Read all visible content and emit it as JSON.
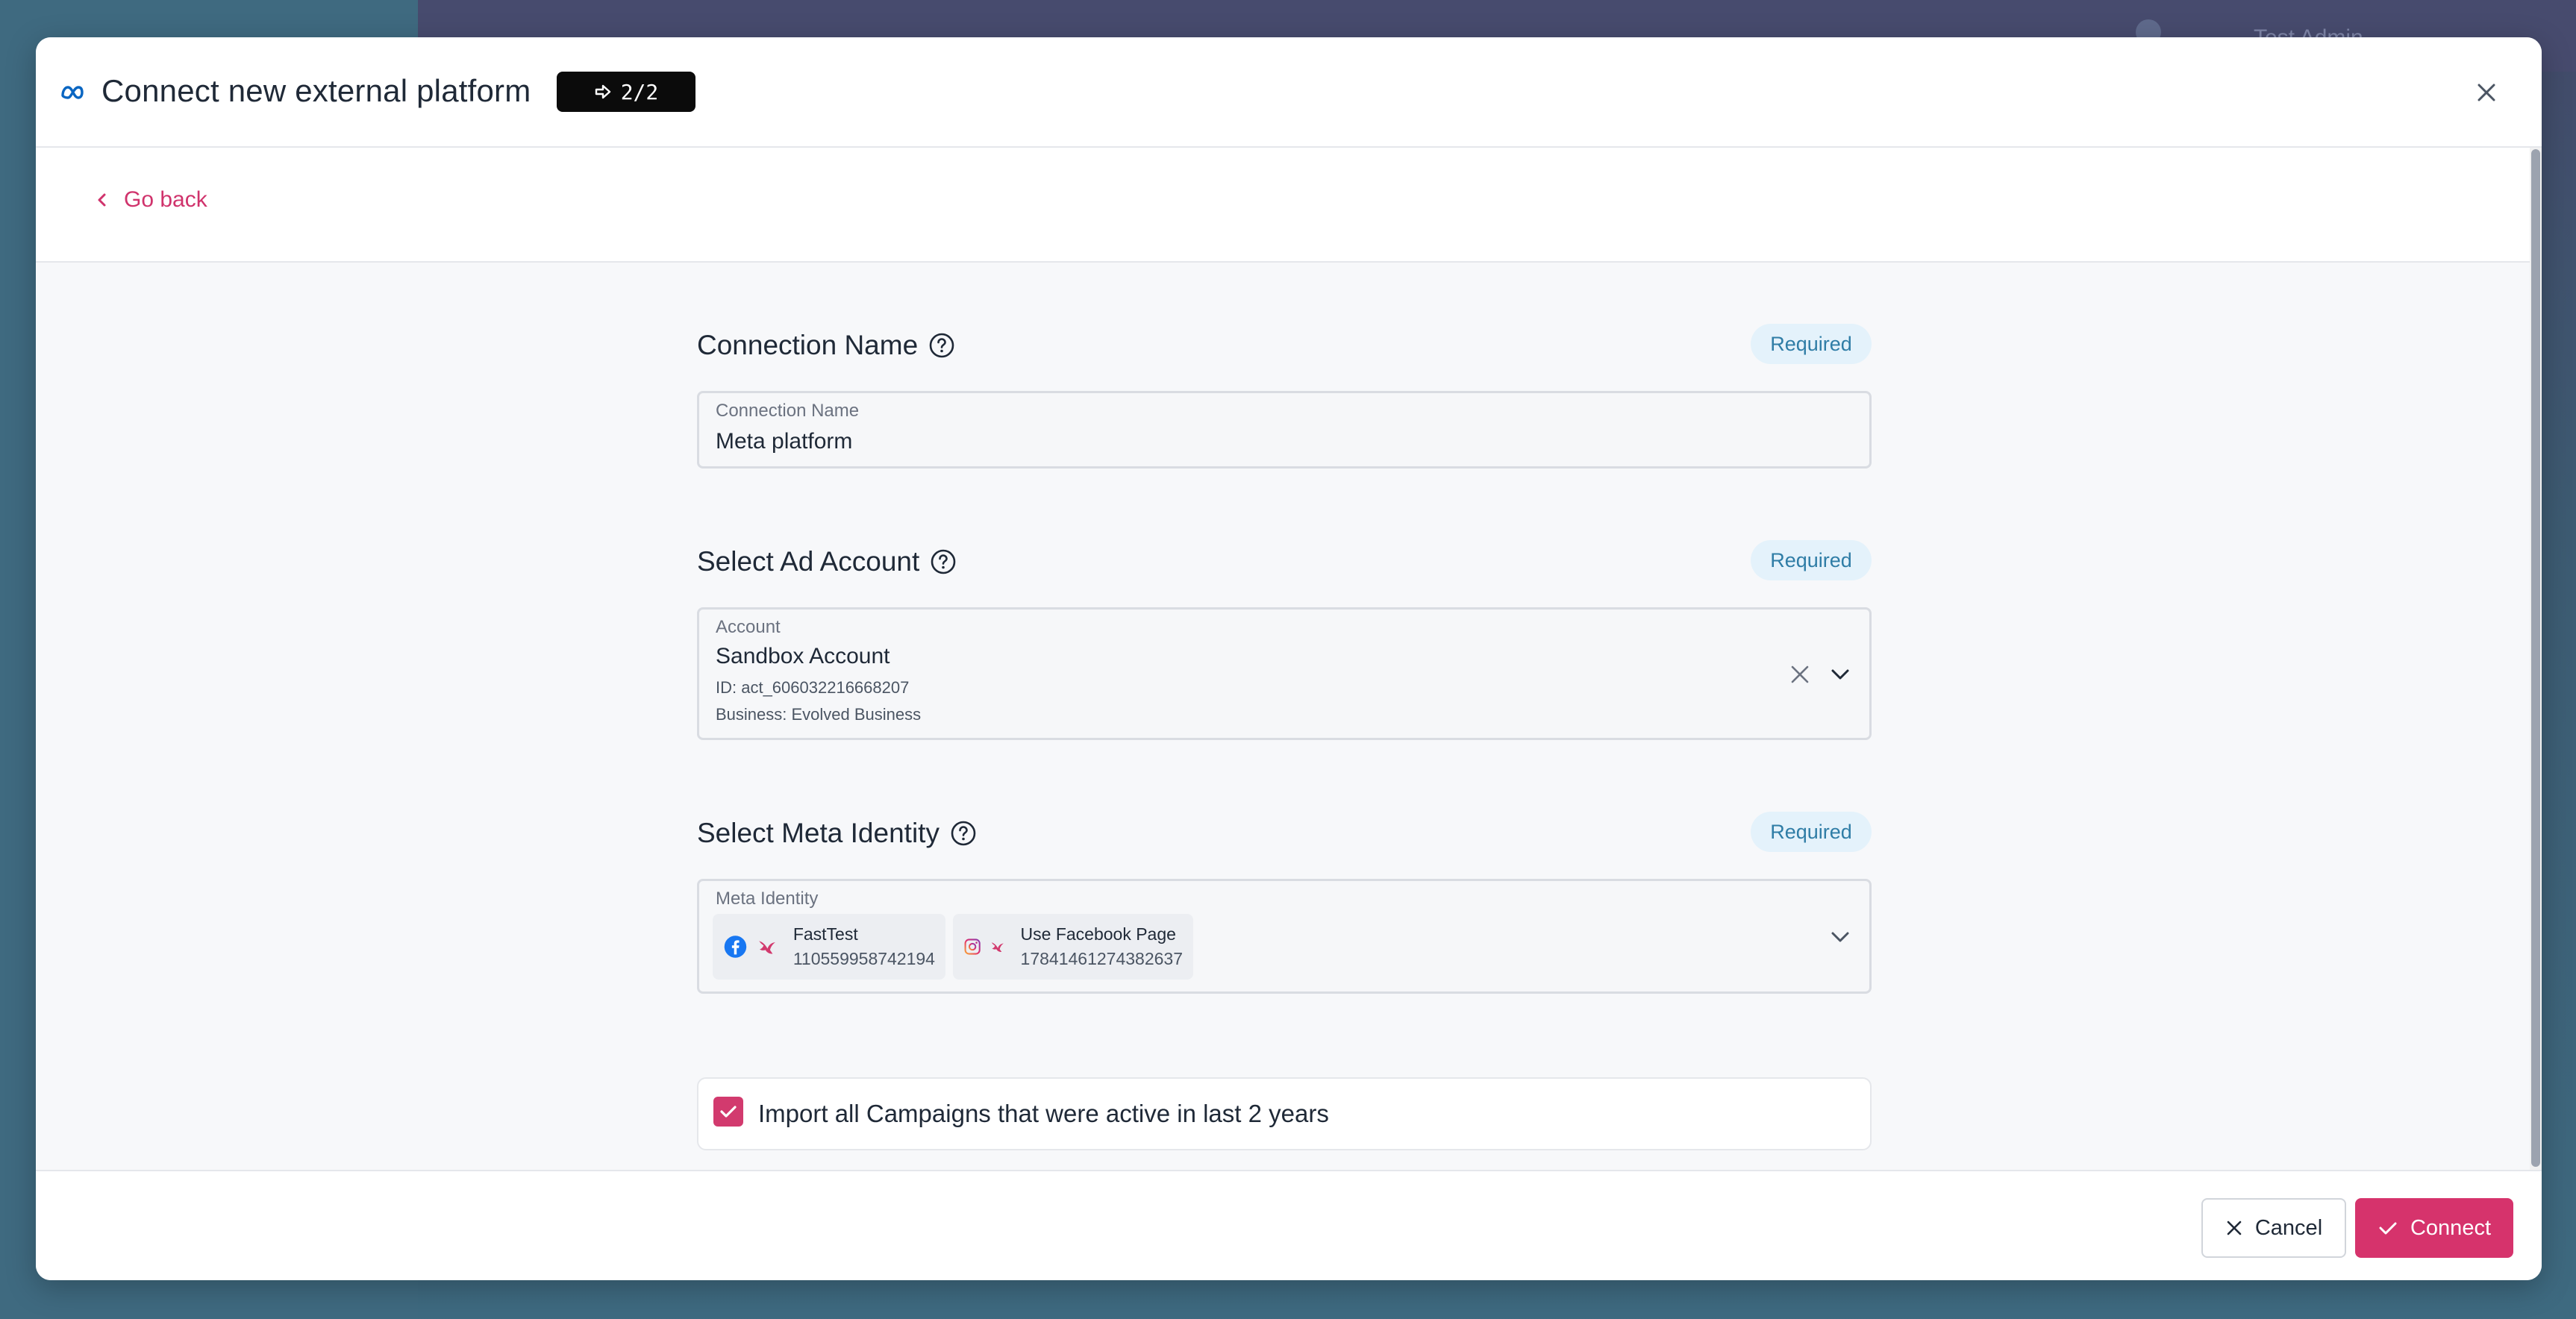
{
  "background": {
    "user_name": "Test Admin"
  },
  "modal": {
    "title": "Connect new external platform",
    "step": "2/2",
    "go_back": "Go back",
    "connection_name": {
      "heading": "Connection Name",
      "required": "Required",
      "field_label": "Connection Name",
      "value": "Meta platform"
    },
    "ad_account": {
      "heading": "Select Ad Account",
      "required": "Required",
      "field_label": "Account",
      "name": "Sandbox Account",
      "id": "ID: act_606032216668207",
      "business": "Business: Evolved Business"
    },
    "meta_identity": {
      "heading": "Select Meta Identity",
      "required": "Required",
      "field_label": "Meta Identity",
      "chips": [
        {
          "name": "FastTest",
          "id": "110559958742194",
          "icon": "facebook-icon"
        },
        {
          "name": "Use Facebook Page",
          "id": "17841461274382637",
          "icon": "instagram-icon"
        }
      ]
    },
    "import": {
      "checked": true,
      "label": "Import all Campaigns that were active in last 2 years"
    },
    "footer": {
      "cancel": "Cancel",
      "connect": "Connect"
    }
  },
  "colors": {
    "accent": "#d6336c",
    "required_bg": "#e4f2fb",
    "required_text": "#2f7da6",
    "meta_blue": "#0a66c2"
  }
}
